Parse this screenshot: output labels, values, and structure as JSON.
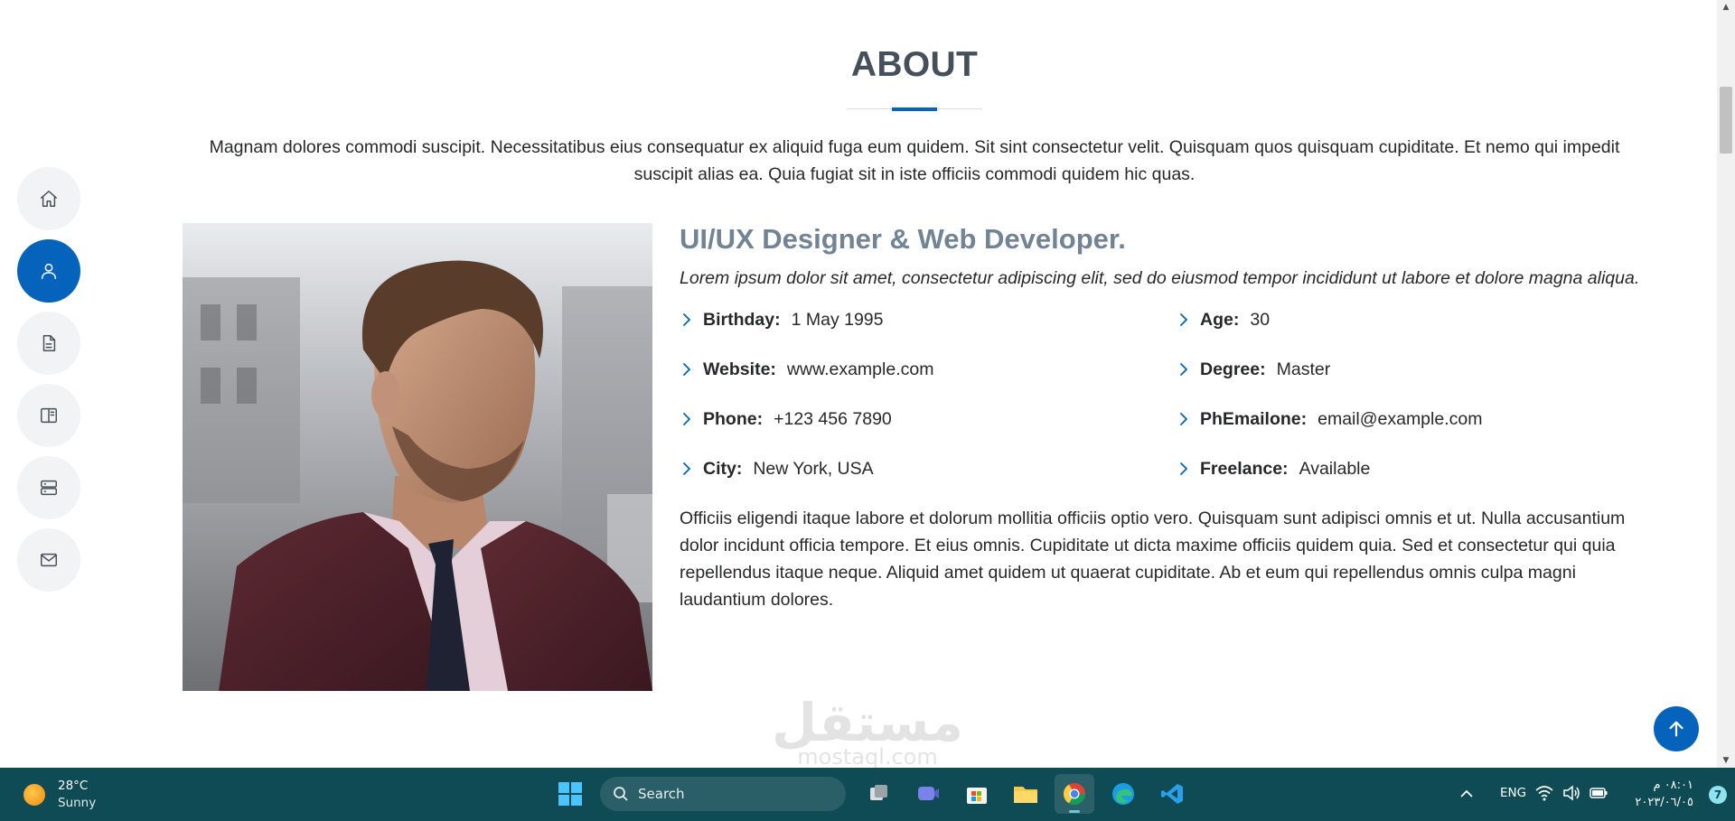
{
  "about": {
    "title": "ABOUT",
    "description": "Magnam dolores commodi suscipit. Necessitatibus eius consequatur ex aliquid fuga eum quidem. Sit sint consectetur velit. Quisquam quos quisquam cupiditate. Et nemo qui impedit suscipit alias ea. Quia fugiat sit in iste officiis commodi quidem hic quas.",
    "role": "UI/UX Designer & Web Developer.",
    "intro": "Lorem ipsum dolor sit amet, consectetur adipiscing elit, sed do eiusmod tempor incididunt ut labore et dolore magna aliqua.",
    "info": {
      "birthday": {
        "label": "Birthday:",
        "value": "1 May 1995"
      },
      "website": {
        "label": "Website:",
        "value": "www.example.com"
      },
      "phone": {
        "label": "Phone:",
        "value": "+123 456 7890"
      },
      "city": {
        "label": "City:",
        "value": "New York, USA"
      },
      "age": {
        "label": "Age:",
        "value": "30"
      },
      "degree": {
        "label": "Degree:",
        "value": "Master"
      },
      "email": {
        "label": "PhEmailone:",
        "value": "email@example.com"
      },
      "freelance": {
        "label": "Freelance:",
        "value": "Available"
      }
    },
    "body": "Officiis eligendi itaque labore et dolorum mollitia officiis optio vero. Quisquam sunt adipisci omnis et ut. Nulla accusantium dolor incidunt officia tempore. Et eius omnis. Cupiditate ut dicta maxime officiis quidem quia. Sed et consectetur qui quia repellendus itaque neque. Aliquid amet quidem ut quaerat cupiditate. Ab et eum qui repellendus omnis culpa magni laudantium dolores."
  },
  "nav": {
    "items": [
      {
        "icon": "home-icon",
        "active": false
      },
      {
        "icon": "person-icon",
        "active": true
      },
      {
        "icon": "file-icon",
        "active": false
      },
      {
        "icon": "book-icon",
        "active": false
      },
      {
        "icon": "server-icon",
        "active": false
      },
      {
        "icon": "envelope-icon",
        "active": false
      }
    ]
  },
  "watermark": {
    "big": "مستقل",
    "small": "mostaql.com"
  },
  "taskbar": {
    "weather": {
      "temp": "28°C",
      "condition": "Sunny"
    },
    "search_label": "Search",
    "lang": "ENG",
    "time": "٠٨:٠١ م",
    "date": "٢٠٢٣/٠٦/٠٥",
    "notification_count": "7"
  },
  "colors": {
    "accent": "#0563bb",
    "heading": "#45505b",
    "subheading": "#728394",
    "taskbar": "#0f4b54"
  }
}
